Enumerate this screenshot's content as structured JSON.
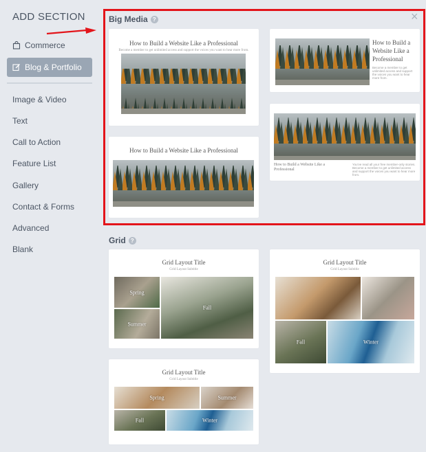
{
  "sidebar": {
    "title": "ADD SECTION",
    "items": [
      {
        "label": "Commerce"
      },
      {
        "label": "Blog & Portfolio"
      }
    ],
    "plain_items": [
      "Image & Video",
      "Text",
      "Call to Action",
      "Feature List",
      "Gallery",
      "Contact & Forms",
      "Advanced",
      "Blank"
    ]
  },
  "sections": {
    "big_media": {
      "label": "Big Media",
      "card1_title": "How to Build a Website Like a Professional",
      "card1_sub": "Become a member to get unlimited access and support the voices you want to hear more from.",
      "card2_title": "How to Build a Website Like a Professional",
      "card3_title": "How to Build a Website Like a Professional",
      "card3_body": "Become a member to get unlimited access and support the voices you want to hear more from.",
      "card4_caption": "How to Build a Website Like a Professional",
      "card4_body": "You've read all your free member-only stories. Become a member to get unlimited access and support the voices you want to hear more from."
    },
    "grid": {
      "label": "Grid",
      "card1": {
        "title": "Grid Layout Title",
        "subtitle": "Grid Layout Subtitle",
        "tiles": [
          "Spring",
          "Fall",
          "Summer"
        ]
      },
      "card2": {
        "title": "Grid Layout Title",
        "subtitle": "Grid Layout Subtitle",
        "tiles": [
          "Fall",
          "Winter"
        ]
      },
      "card3": {
        "title": "Grid Layout Title",
        "subtitle": "Grid Layout Subtitle",
        "tiles": [
          "Spring",
          "Summer",
          "Fall",
          "Winter"
        ]
      }
    }
  },
  "icons": {
    "close": "×",
    "help": "?"
  },
  "colors": {
    "highlight": "#e3141a",
    "active_nav": "#9aa6b4",
    "background": "#e6e9ee"
  }
}
